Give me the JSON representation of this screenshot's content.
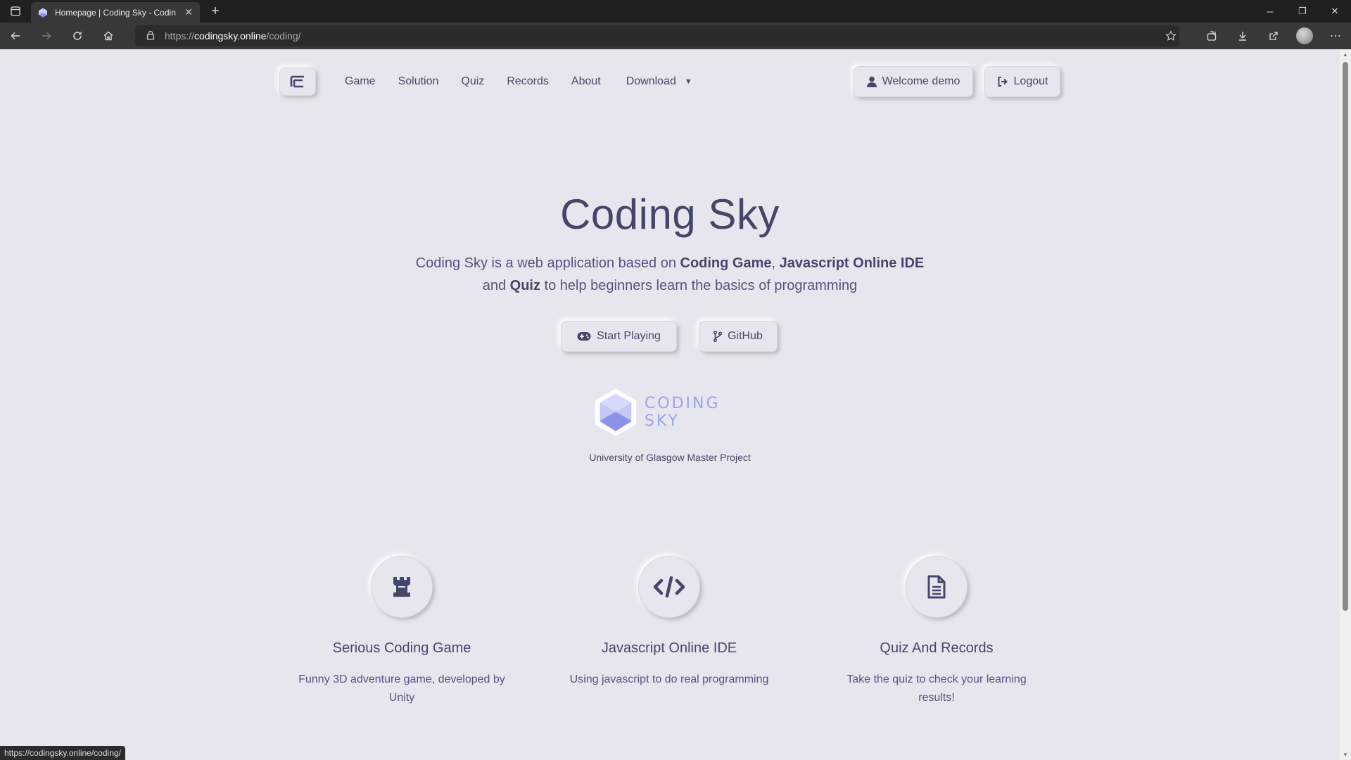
{
  "browser": {
    "tab_title": "Homepage | Coding Sky - Codin",
    "url_scheme": "https://",
    "url_host": "codingsky.online",
    "url_path": "/coding/",
    "status_url": "https://codingsky.online/coding/"
  },
  "nav": {
    "links": [
      "Game",
      "Solution",
      "Quiz",
      "Records",
      "About",
      "Download"
    ],
    "welcome_label": "Welcome demo",
    "logout_label": "Logout"
  },
  "hero": {
    "title": "Coding Sky",
    "desc_1": "Coding Sky is a web application based on ",
    "desc_b1": "Coding Game",
    "desc_2": ", ",
    "desc_b2": "Javascript Online IDE",
    "desc_3": "and ",
    "desc_b3": "Quiz",
    "desc_4": " to help beginners learn the basics of programming",
    "start_label": "Start Playing",
    "github_label": "GitHub",
    "logo_text": "CODING SKY",
    "caption": "University of Glasgow Master Project"
  },
  "features": [
    {
      "icon": "chess-rook-icon",
      "title": "Serious Coding Game",
      "text": "Funny 3D adventure game, developed by Unity"
    },
    {
      "icon": "code-icon",
      "title": "Javascript Online IDE",
      "text": "Using javascript to do real programming"
    },
    {
      "icon": "file-icon",
      "title": "Quiz And Records",
      "text": "Take the quiz to check your learning results!"
    }
  ],
  "colors": {
    "background": "#e6e7ee",
    "text": "#44476a",
    "logo_accent": "#9aa3ec"
  }
}
